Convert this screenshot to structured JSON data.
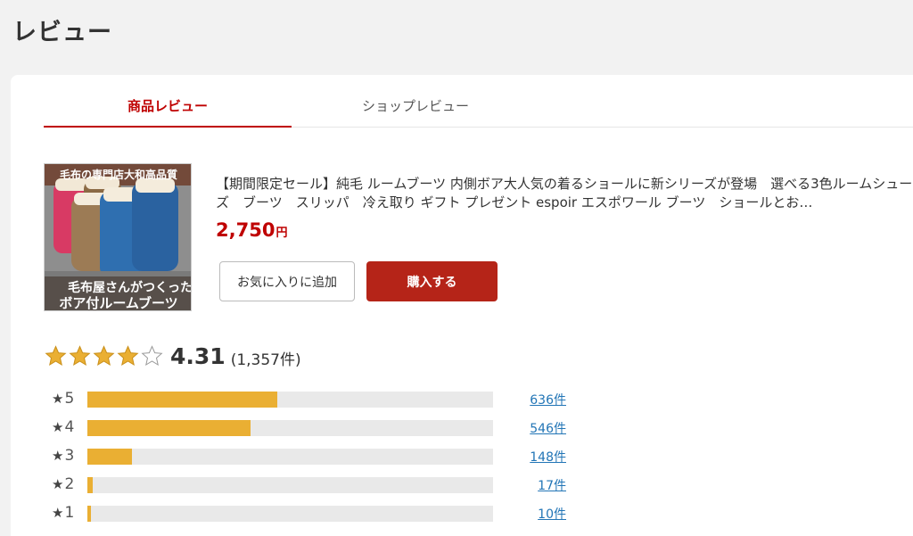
{
  "page": {
    "title": "レビュー"
  },
  "tabs": [
    {
      "label": "商品レビュー",
      "active": true
    },
    {
      "label": "ショップレビュー",
      "active": false
    }
  ],
  "product": {
    "name": "【期間限定セール】純毛 ルームブーツ 内側ボア大人気の着るショールに新シリーズが登場　選べる3色ルームシューズ　ブーツ　スリッパ　冷え取り ギフト プレゼント espoir エスポワール ブーツ　ショールとお…",
    "price": "2,750",
    "currency": "円",
    "image_banner_top": "毛布の専門店大和高品質",
    "image_banner_line1": "毛布屋さんがつくった",
    "image_banner_line2": "ボア付ルームブーツ",
    "favorite_button": "お気に入りに追加",
    "buy_button": "購入する"
  },
  "rating": {
    "average": "4.31",
    "count": "(1,357件)",
    "stars_filled": 4.31,
    "star_color": "#eaaf33"
  },
  "distribution": [
    {
      "stars": "5",
      "count_label": "636件",
      "fraction": 0.469
    },
    {
      "stars": "4",
      "count_label": "546件",
      "fraction": 0.402
    },
    {
      "stars": "3",
      "count_label": "148件",
      "fraction": 0.109
    },
    {
      "stars": "2",
      "count_label": "17件",
      "fraction": 0.0125
    },
    {
      "stars": "1",
      "count_label": "10件",
      "fraction": 0.0074
    }
  ],
  "colors": {
    "accent": "#bf0000",
    "buy": "#b52418",
    "bar": "#eaaf33",
    "link": "#2275b6"
  }
}
